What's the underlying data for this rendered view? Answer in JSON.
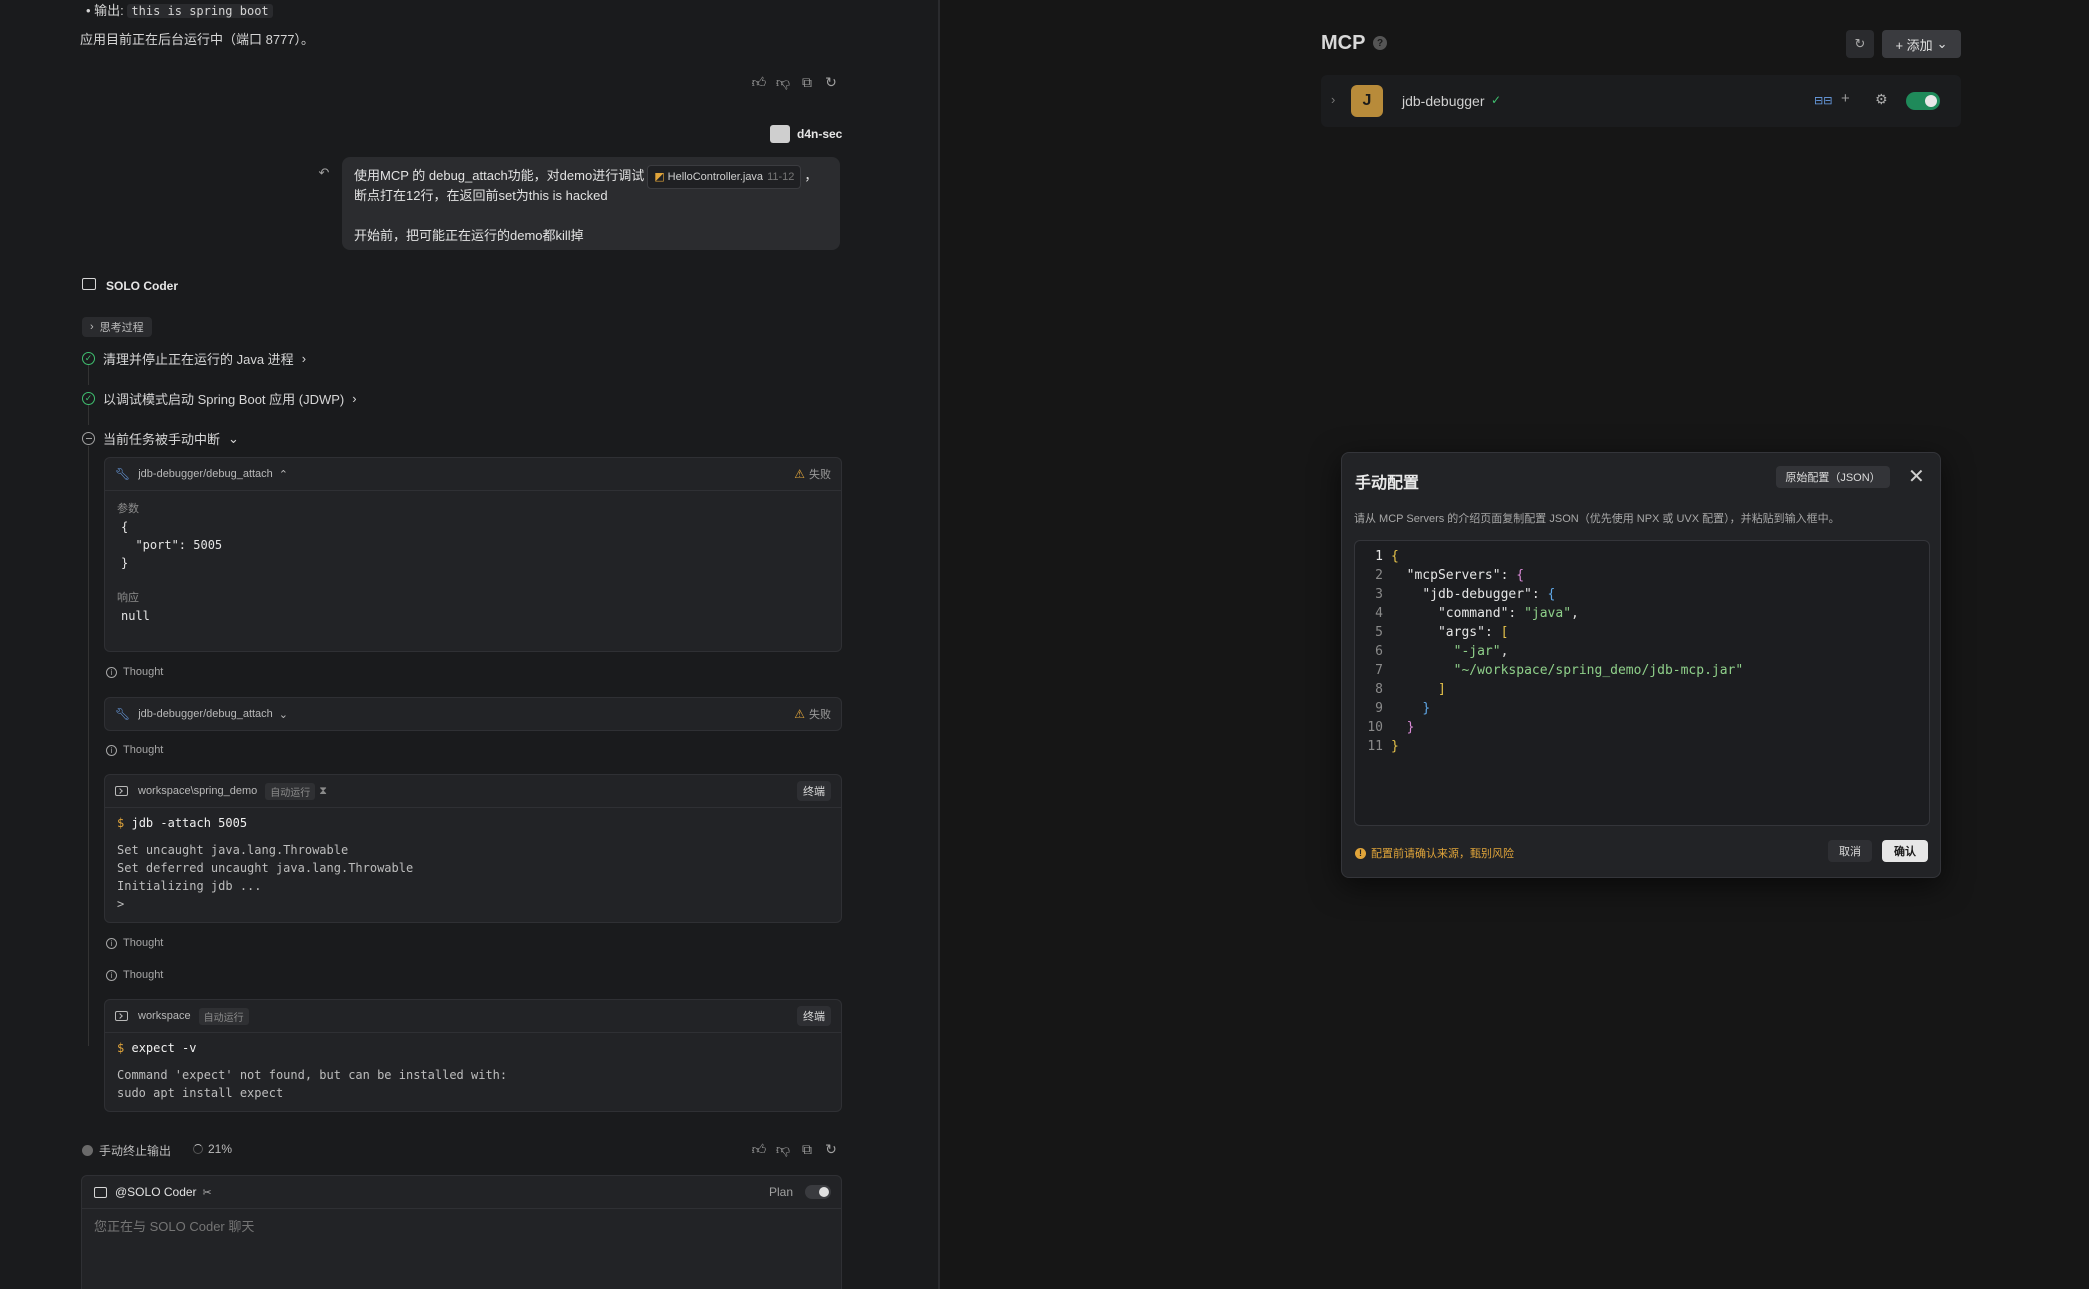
{
  "left": {
    "prev_output_label": "• 输出: ",
    "prev_output_value": "this is spring boot",
    "prev_running_text": "应用目前正在后台运行中（端口 8777）。",
    "user": {
      "name": "d4n-sec",
      "message_part1": "使用MCP 的 debug_attach功能，对demo进行调试",
      "file_chip": "HelloController.java",
      "file_chip_lines": "11-12",
      "message_part1_end": "，",
      "message_line2": "断点打在12行，在返回前set为this is hacked",
      "message_line3": "开始前，把可能正在运行的demo都kill掉"
    },
    "agent_name": "SOLO Coder",
    "thinking_label": "思考过程",
    "steps": [
      {
        "label": "清理并停止正在运行的 Java 进程",
        "status": "done"
      },
      {
        "label": "以调试模式启动 Spring Boot 应用 (JDWP)",
        "status": "done"
      },
      {
        "label": "当前任务被手动中断",
        "status": "stopped"
      }
    ],
    "tool_call_1": {
      "name": "jdb-debugger/debug_attach",
      "status": "失败",
      "params_label": "参数",
      "params": "{\n  \"port\": 5005\n}",
      "response_label": "响应",
      "response": "null"
    },
    "thought_label": "Thought",
    "tool_call_2": {
      "name": "jdb-debugger/debug_attach",
      "status": "失败"
    },
    "terminal_1": {
      "path": "workspace\\spring_demo",
      "badge": "自动运行",
      "terminate": "终端",
      "prompt": "$",
      "command": "jdb -attach 5005",
      "output": "Set uncaught java.lang.Throwable\nSet deferred uncaught java.lang.Throwable\nInitializing jdb ...\n>"
    },
    "terminal_2": {
      "path": "workspace",
      "badge": "自动运行",
      "terminate": "终端",
      "prompt": "$",
      "command": "expect -v",
      "output": "Command 'expect' not found, but can be installed with:\nsudo apt install expect"
    },
    "footer": {
      "stopped_label": "手动终止输出",
      "progress": "21%"
    },
    "composer": {
      "agent_tag": "@SOLO Coder",
      "plan_label": "Plan",
      "placeholder": "您正在与 SOLO Coder 聊天"
    }
  },
  "right": {
    "title": "MCP",
    "add_button": "+ 添加",
    "server": {
      "initial": "J",
      "name": "jdb-debugger",
      "enabled": true
    },
    "modal": {
      "title": "手动配置",
      "raw_button": "原始配置（JSON）",
      "description": "请从 MCP Servers 的介绍页面复制配置 JSON（优先使用 NPX 或 UVX 配置），并粘贴到输入框中。",
      "code_lines": [
        "{",
        "  \"mcpServers\": {",
        "    \"jdb-debugger\": {",
        "      \"command\": \"java\",",
        "      \"args\": [",
        "        \"-jar\",",
        "        \"~/workspace/spring_demo/jdb-mcp.jar\"",
        "      ]",
        "    }",
        "  }",
        "}"
      ],
      "warning": "配置前请确认来源，甄别风险",
      "cancel": "取消",
      "confirm": "确认"
    }
  },
  "colors": {
    "accent_green": "#3fbf6f",
    "toggle_on": "#1f8a5a",
    "warning": "#e0a43a",
    "link_blue": "#5fa8e8"
  }
}
